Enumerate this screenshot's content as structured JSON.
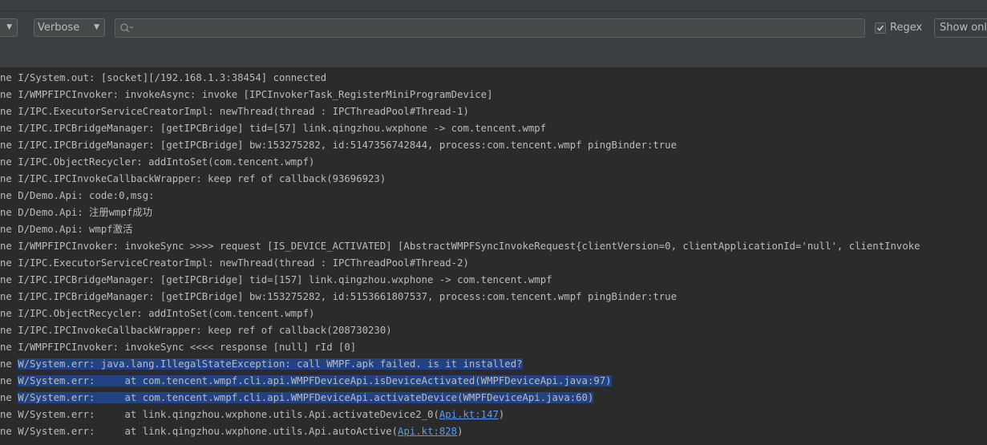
{
  "toolbar": {
    "level_select": {
      "value": "Verbose"
    },
    "search": {
      "value": "",
      "placeholder": ""
    },
    "regex": {
      "label": "Regex",
      "checked": true
    },
    "show_only": {
      "label": "Show only"
    }
  },
  "colors": {
    "background": "#2b2b2b",
    "toolbar": "#3c3f41",
    "text": "#bbbbbb",
    "selection": "#214283",
    "link": "#589df6"
  },
  "log_lines": [
    {
      "prefix": "ne ",
      "text": "I/System.out: [socket][/192.168.1.3:38454] connected",
      "selected": false
    },
    {
      "prefix": "ne ",
      "text": "I/WMPFIPCInvoker: invokeAsync: invoke [IPCInvokerTask_RegisterMiniProgramDevice]",
      "selected": false
    },
    {
      "prefix": "ne ",
      "text": "I/IPC.ExecutorServiceCreatorImpl: newThread(thread : IPCThreadPool#Thread-1)",
      "selected": false
    },
    {
      "prefix": "ne ",
      "text": "I/IPC.IPCBridgeManager: [getIPCBridge] tid=[57] link.qingzhou.wxphone -> com.tencent.wmpf",
      "selected": false
    },
    {
      "prefix": "ne ",
      "text": "I/IPC.IPCBridgeManager: [getIPCBridge] bw:153275282, id:5147356742844, process:com.tencent.wmpf pingBinder:true",
      "selected": false
    },
    {
      "prefix": "ne ",
      "text": "I/IPC.ObjectRecycler: addIntoSet(com.tencent.wmpf)",
      "selected": false
    },
    {
      "prefix": "ne ",
      "text": "I/IPC.IPCInvokeCallbackWrapper: keep ref of callback(93696923)",
      "selected": false
    },
    {
      "prefix": "ne ",
      "text": "D/Demo.Api: code:0,msg:",
      "selected": false
    },
    {
      "prefix": "ne ",
      "text": "D/Demo.Api: 注册wmpf成功",
      "selected": false
    },
    {
      "prefix": "ne ",
      "text": "D/Demo.Api: wmpf激活",
      "selected": false
    },
    {
      "prefix": "ne ",
      "text": "I/WMPFIPCInvoker: invokeSync >>>> request [IS_DEVICE_ACTIVATED] [AbstractWMPFSyncInvokeRequest{clientVersion=0, clientApplicationId='null', clientInvoke",
      "selected": false
    },
    {
      "prefix": "ne ",
      "text": "I/IPC.ExecutorServiceCreatorImpl: newThread(thread : IPCThreadPool#Thread-2)",
      "selected": false
    },
    {
      "prefix": "ne ",
      "text": "I/IPC.IPCBridgeManager: [getIPCBridge] tid=[157] link.qingzhou.wxphone -> com.tencent.wmpf",
      "selected": false
    },
    {
      "prefix": "ne ",
      "text": "I/IPC.IPCBridgeManager: [getIPCBridge] bw:153275282, id:5153661807537, process:com.tencent.wmpf pingBinder:true",
      "selected": false
    },
    {
      "prefix": "ne ",
      "text": "I/IPC.ObjectRecycler: addIntoSet(com.tencent.wmpf)",
      "selected": false
    },
    {
      "prefix": "ne ",
      "text": "I/IPC.IPCInvokeCallbackWrapper: keep ref of callback(208730230)",
      "selected": false
    },
    {
      "prefix": "ne ",
      "text": "I/WMPFIPCInvoker: invokeSync <<<< response [null] rId [0]",
      "selected": false
    },
    {
      "prefix": "ne ",
      "text": "W/System.err: java.lang.IllegalStateException: call WMPF.apk failed. is it installed?",
      "selected": true
    },
    {
      "prefix": "ne ",
      "text": "W/System.err:     at com.tencent.wmpf.cli.api.WMPFDeviceApi.isDeviceActivated(WMPFDeviceApi.java:97)",
      "selected": true
    },
    {
      "prefix": "ne ",
      "text": "W/System.err:     at com.tencent.wmpf.cli.api.WMPFDeviceApi.activateDevice(WMPFDeviceApi.java:60)",
      "selected": true
    },
    {
      "prefix": "ne ",
      "text": "W/System.err:     at link.qingzhou.wxphone.utils.Api.activateDevice2_0(",
      "link": "Api.kt:147",
      "suffix": ")",
      "selected": false
    },
    {
      "prefix": "ne ",
      "text": "W/System.err:     at link.qingzhou.wxphone.utils.Api.autoActive(",
      "link": "Api.kt:828",
      "suffix": ")",
      "selected": false
    }
  ]
}
